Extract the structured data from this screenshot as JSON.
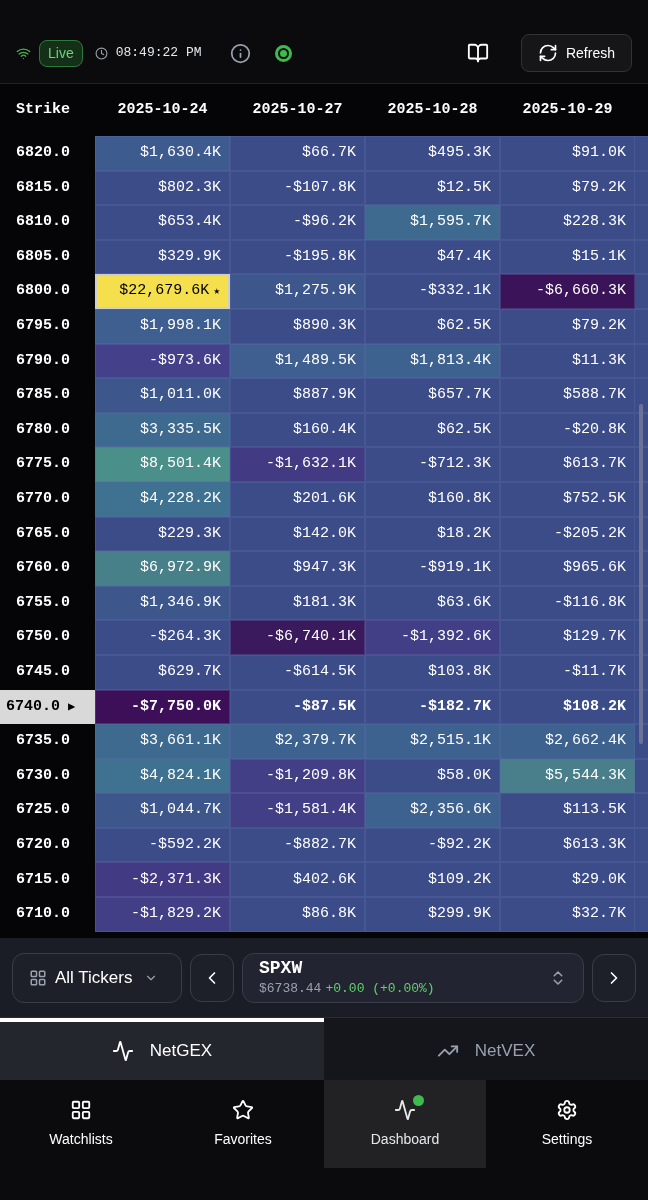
{
  "top_bar": {
    "status": "Live",
    "time": "08:49:22 PM",
    "live_indicator": true,
    "refresh_label": "Refresh"
  },
  "table": {
    "columns": [
      "Strike",
      "2025-10-24",
      "2025-10-27",
      "2025-10-28",
      "2025-10-29"
    ],
    "rows": [
      {
        "current": false,
        "cells": [
          {
            "text": "6820.0"
          },
          {
            "text": "$1,630.4K",
            "color": "#3e5b8f"
          },
          {
            "text": "$66.7K",
            "color": "#3b4c88"
          },
          {
            "text": "$495.3K",
            "color": "#3b4c88"
          },
          {
            "text": "$91.0K",
            "color": "#3b4c88"
          }
        ]
      },
      {
        "current": false,
        "cells": [
          {
            "text": "6815.0"
          },
          {
            "text": "$802.3K",
            "color": "#3b4c88"
          },
          {
            "text": "-$107.8K",
            "color": "#3b4c88"
          },
          {
            "text": "$12.5K",
            "color": "#3b4c88"
          },
          {
            "text": "$79.2K",
            "color": "#3b4c88"
          }
        ]
      },
      {
        "current": false,
        "cells": [
          {
            "text": "6810.0"
          },
          {
            "text": "$653.4K",
            "color": "#3b4c88"
          },
          {
            "text": "-$96.2K",
            "color": "#3b4c88"
          },
          {
            "text": "$1,595.7K",
            "color": "#3f6a8f"
          },
          {
            "text": "$228.3K",
            "color": "#3b4c88"
          }
        ]
      },
      {
        "current": false,
        "cells": [
          {
            "text": "6805.0"
          },
          {
            "text": "$329.9K",
            "color": "#3b4c88"
          },
          {
            "text": "-$195.8K",
            "color": "#3b4c88"
          },
          {
            "text": "$47.4K",
            "color": "#3b4c88"
          },
          {
            "text": "$15.1K",
            "color": "#3b4c88"
          }
        ]
      },
      {
        "current": false,
        "cells": [
          {
            "text": "6800.0"
          },
          {
            "text": "$22,679.6K",
            "color": "#f5df4d",
            "badge": "★"
          },
          {
            "text": "$1,275.9K",
            "color": "#3d578c"
          },
          {
            "text": "-$332.1K",
            "color": "#3b4c88"
          },
          {
            "text": "-$6,660.3K",
            "color": "#3b1358"
          }
        ]
      },
      {
        "current": false,
        "cells": [
          {
            "text": "6795.0"
          },
          {
            "text": "$1,998.1K",
            "color": "#3e5f8f"
          },
          {
            "text": "$890.3K",
            "color": "#3b4c88"
          },
          {
            "text": "$62.5K",
            "color": "#3b4c88"
          },
          {
            "text": "$79.2K",
            "color": "#3b4c88"
          }
        ]
      },
      {
        "current": false,
        "cells": [
          {
            "text": "6790.0"
          },
          {
            "text": "-$973.6K",
            "color": "#44408a"
          },
          {
            "text": "$1,489.5K",
            "color": "#3e5f8f"
          },
          {
            "text": "$1,813.4K",
            "color": "#3e628f"
          },
          {
            "text": "$11.3K",
            "color": "#3b4c88"
          }
        ]
      },
      {
        "current": false,
        "cells": [
          {
            "text": "6785.0"
          },
          {
            "text": "$1,011.0K",
            "color": "#3d568c"
          },
          {
            "text": "$887.9K",
            "color": "#3b4c88"
          },
          {
            "text": "$657.7K",
            "color": "#3b4c88"
          },
          {
            "text": "$588.7K",
            "color": "#3b4c88"
          }
        ]
      },
      {
        "current": false,
        "cells": [
          {
            "text": "6780.0"
          },
          {
            "text": "$3,335.5K",
            "color": "#3f6a8f"
          },
          {
            "text": "$160.4K",
            "color": "#3b4c88"
          },
          {
            "text": "$62.5K",
            "color": "#3b4c88"
          },
          {
            "text": "-$20.8K",
            "color": "#3b4c88"
          }
        ]
      },
      {
        "current": false,
        "cells": [
          {
            "text": "6775.0"
          },
          {
            "text": "$8,501.4K",
            "color": "#4b8f8a"
          },
          {
            "text": "-$1,632.1K",
            "color": "#433a84"
          },
          {
            "text": "-$712.3K",
            "color": "#3b4c88"
          },
          {
            "text": "$613.7K",
            "color": "#3b4c88"
          }
        ]
      },
      {
        "current": false,
        "cells": [
          {
            "text": "6770.0"
          },
          {
            "text": "$4,228.2K",
            "color": "#3f7190"
          },
          {
            "text": "$201.6K",
            "color": "#3b4c88"
          },
          {
            "text": "$160.8K",
            "color": "#3b4c88"
          },
          {
            "text": "$752.5K",
            "color": "#3b4c88"
          }
        ]
      },
      {
        "current": false,
        "cells": [
          {
            "text": "6765.0"
          },
          {
            "text": "$229.3K",
            "color": "#3b4c88"
          },
          {
            "text": "$142.0K",
            "color": "#3b4c88"
          },
          {
            "text": "$18.2K",
            "color": "#3b4c88"
          },
          {
            "text": "-$205.2K",
            "color": "#3b4c88"
          }
        ]
      },
      {
        "current": false,
        "cells": [
          {
            "text": "6760.0"
          },
          {
            "text": "$6,972.9K",
            "color": "#478088"
          },
          {
            "text": "$947.3K",
            "color": "#3b4c88"
          },
          {
            "text": "-$919.1K",
            "color": "#3b4c88"
          },
          {
            "text": "$965.6K",
            "color": "#3b4c88"
          }
        ]
      },
      {
        "current": false,
        "cells": [
          {
            "text": "6755.0"
          },
          {
            "text": "$1,346.9K",
            "color": "#3d578c"
          },
          {
            "text": "$181.3K",
            "color": "#3b4c88"
          },
          {
            "text": "$63.6K",
            "color": "#3b4c88"
          },
          {
            "text": "-$116.8K",
            "color": "#3b4c88"
          }
        ]
      },
      {
        "current": false,
        "cells": [
          {
            "text": "6750.0"
          },
          {
            "text": "-$264.3K",
            "color": "#3b4c88"
          },
          {
            "text": "-$6,740.1K",
            "color": "#3a1a5c"
          },
          {
            "text": "-$1,392.6K",
            "color": "#433f86"
          },
          {
            "text": "$129.7K",
            "color": "#3b4c88"
          }
        ]
      },
      {
        "current": false,
        "cells": [
          {
            "text": "6745.0"
          },
          {
            "text": "$629.7K",
            "color": "#3b4c88"
          },
          {
            "text": "-$614.5K",
            "color": "#3b4c88"
          },
          {
            "text": "$103.8K",
            "color": "#3b4c88"
          },
          {
            "text": "-$11.7K",
            "color": "#3b4c88"
          }
        ]
      },
      {
        "current": true,
        "marker": "▶",
        "cells": [
          {
            "text": "6740.0"
          },
          {
            "text": "-$7,750.0K",
            "color": "#3d0f58"
          },
          {
            "text": "-$87.5K",
            "color": "#3b4c88"
          },
          {
            "text": "-$182.7K",
            "color": "#3b4c88"
          },
          {
            "text": "$108.2K",
            "color": "#3b4c88"
          }
        ]
      },
      {
        "current": false,
        "cells": [
          {
            "text": "6735.0"
          },
          {
            "text": "$3,661.1K",
            "color": "#3f6a8f"
          },
          {
            "text": "$2,379.7K",
            "color": "#3e628f"
          },
          {
            "text": "$2,515.1K",
            "color": "#3e628f"
          },
          {
            "text": "$2,662.4K",
            "color": "#3e628f"
          }
        ]
      },
      {
        "current": false,
        "cells": [
          {
            "text": "6730.0"
          },
          {
            "text": "$4,824.1K",
            "color": "#3f7190"
          },
          {
            "text": "-$1,209.8K",
            "color": "#433f86"
          },
          {
            "text": "$58.0K",
            "color": "#3b4c88"
          },
          {
            "text": "$5,544.3K",
            "color": "#487f8a"
          }
        ]
      },
      {
        "current": false,
        "cells": [
          {
            "text": "6725.0"
          },
          {
            "text": "$1,044.7K",
            "color": "#3d568c"
          },
          {
            "text": "-$1,581.4K",
            "color": "#433f86"
          },
          {
            "text": "$2,356.6K",
            "color": "#3e628f"
          },
          {
            "text": "$113.5K",
            "color": "#3b4c88"
          }
        ]
      },
      {
        "current": false,
        "cells": [
          {
            "text": "6720.0"
          },
          {
            "text": "-$592.2K",
            "color": "#3b4c88"
          },
          {
            "text": "-$882.7K",
            "color": "#3b4c88"
          },
          {
            "text": "-$92.2K",
            "color": "#3b4c88"
          },
          {
            "text": "$613.3K",
            "color": "#3b4c88"
          }
        ]
      },
      {
        "current": false,
        "cells": [
          {
            "text": "6715.0"
          },
          {
            "text": "-$2,371.3K",
            "color": "#433a84"
          },
          {
            "text": "$402.6K",
            "color": "#3b4c88"
          },
          {
            "text": "$109.2K",
            "color": "#3b4c88"
          },
          {
            "text": "$29.0K",
            "color": "#3b4c88"
          }
        ]
      },
      {
        "current": false,
        "cells": [
          {
            "text": "6710.0"
          },
          {
            "text": "-$1,829.2K",
            "color": "#433f86"
          },
          {
            "text": "$86.8K",
            "color": "#3b4c88"
          },
          {
            "text": "$299.9K",
            "color": "#3b4c88"
          },
          {
            "text": "$32.7K",
            "color": "#3b4c88"
          }
        ]
      }
    ]
  },
  "ticker_bar": {
    "filter": "All Tickers",
    "symbol": "SPXW",
    "price": "$6738.44",
    "change": "+0.00 (+0.00%)"
  },
  "view_tabs": [
    {
      "label": "NetGEX",
      "selected": true
    },
    {
      "label": "NetVEX",
      "selected": false
    }
  ],
  "nav": [
    {
      "label": "Watchlists",
      "selected": false,
      "dot": false
    },
    {
      "label": "Favorites",
      "selected": false,
      "dot": false
    },
    {
      "label": "Dashboard",
      "selected": true,
      "dot": true
    },
    {
      "label": "Settings",
      "selected": false,
      "dot": false
    }
  ]
}
